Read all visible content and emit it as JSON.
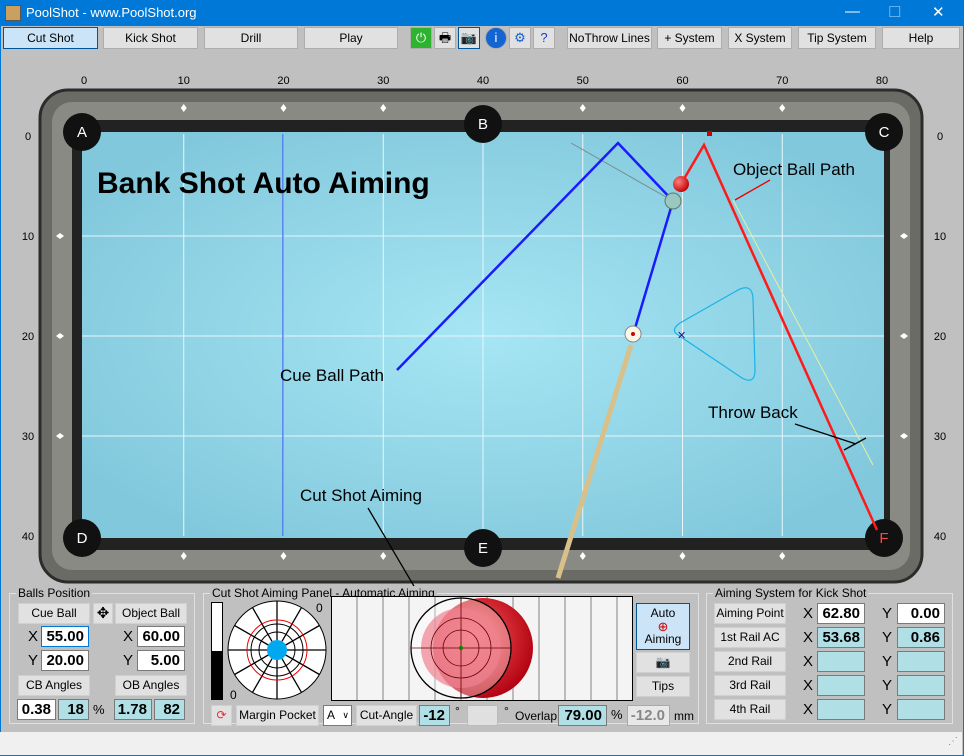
{
  "window": {
    "title": "PoolShot - www.PoolShot.org"
  },
  "toolbar": {
    "tabs": [
      "Cut Shot",
      "Kick Shot",
      "Drill",
      "Play"
    ],
    "icons": [
      "power-icon",
      "print-icon",
      "camera-icon",
      "info-icon",
      "gear-icon",
      "help-doc-icon"
    ],
    "buttons": [
      "NoThrow Lines",
      "+ System",
      "X System",
      "Tip System",
      "Help"
    ]
  },
  "table": {
    "x_ticks": [
      "0",
      "10",
      "20",
      "30",
      "40",
      "50",
      "60",
      "70",
      "80"
    ],
    "y_ticks": [
      "0",
      "10",
      "20",
      "30",
      "40"
    ],
    "pockets": [
      "A",
      "B",
      "C",
      "D",
      "E",
      "F"
    ],
    "title": "Bank Shot Auto Aiming",
    "annotations": {
      "object_ball_path": "Object Ball Path",
      "cue_ball_path": "Cue Ball Path",
      "throw_back": "Throw Back",
      "cut_shot_aiming": "Cut Shot Aiming"
    },
    "colors": {
      "felt": "#9ad8ea",
      "cue_path": "#1a1aff",
      "object_path": "#ff1a1a",
      "rack": "#1ab2e6"
    }
  },
  "balls_position": {
    "title": "Balls Position",
    "cue_ball": "Cue Ball",
    "object_ball": "Object Ball",
    "x_label": "X",
    "y_label": "Y",
    "cb_x": "55.00",
    "cb_y": "20.00",
    "ob_x": "60.00",
    "ob_y": "5.00",
    "cb_angles": "CB Angles",
    "ob_angles": "OB Angles",
    "cb_a1": "0.38",
    "cb_a2": "18",
    "pct": "%",
    "ob_a1": "1.78",
    "ob_a2": "82"
  },
  "aiming_panel": {
    "title": "Cut Shot Aiming Panel - Automatic Aiming",
    "zero1": "0",
    "zero2": "0",
    "margin_pocket": "Margin Pocket",
    "pocket_select": "A",
    "cut_angle": "Cut-Angle",
    "cut_angle_value": "-12",
    "deg": "°",
    "overlap": "Overlap",
    "overlap_value": "79.00",
    "pct": "%",
    "mm_value": "-12.0",
    "mm": "mm",
    "auto_aiming": "Auto",
    "auto_aiming2": "Aiming",
    "tips": "Tips"
  },
  "kick_system": {
    "title": "Aiming System for Kick Shot",
    "rows": [
      {
        "label": "Aiming Point",
        "x": "62.80",
        "y": "0.00",
        "white": true
      },
      {
        "label": "1st Rail AC",
        "x": "53.68",
        "y": "0.86"
      },
      {
        "label": "2nd Rail",
        "x": "",
        "y": ""
      },
      {
        "label": "3rd Rail",
        "x": "",
        "y": ""
      },
      {
        "label": "4th Rail",
        "x": "",
        "y": ""
      }
    ],
    "x_label": "X",
    "y_label": "Y"
  }
}
